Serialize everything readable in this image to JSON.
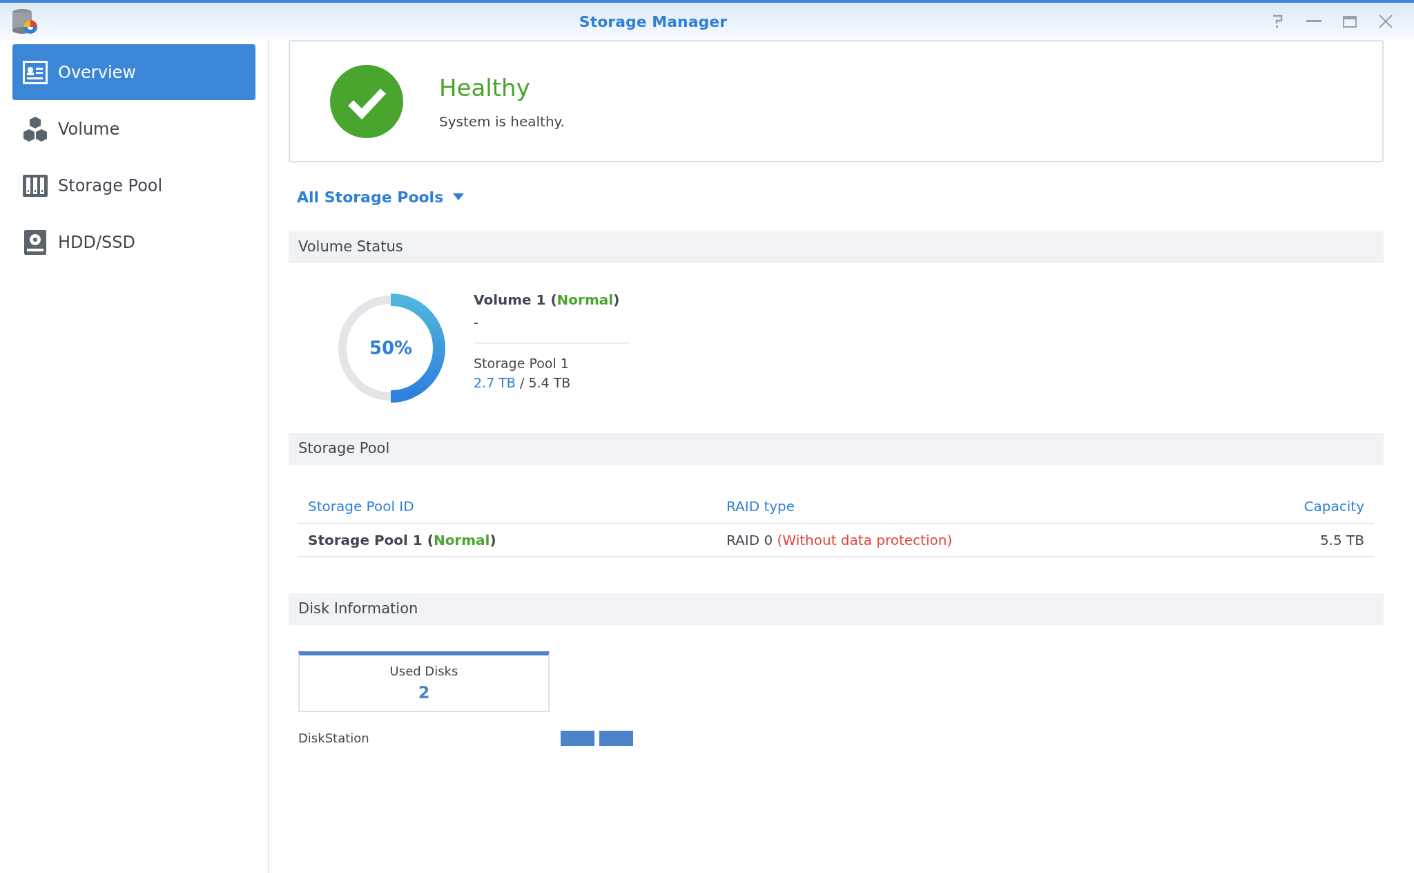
{
  "window": {
    "title": "Storage Manager"
  },
  "sidebar": {
    "items": [
      {
        "label": "Overview",
        "selected": true
      },
      {
        "label": "Volume",
        "selected": false
      },
      {
        "label": "Storage Pool",
        "selected": false
      },
      {
        "label": "HDD/SSD",
        "selected": false
      }
    ]
  },
  "health": {
    "title": "Healthy",
    "message": "System is healthy."
  },
  "pool_selector": {
    "label": "All Storage Pools"
  },
  "volume_status": {
    "heading": "Volume Status",
    "volumes": [
      {
        "level": 0.5,
        "reading": "50%",
        "name": [
          {
            "text": "Volume 1 (",
            "kind": "plain"
          },
          {
            "text": "Normal",
            "kind": "status"
          },
          {
            "text": ")",
            "kind": "plain"
          }
        ],
        "description": "-",
        "pool": "Storage Pool 1",
        "used": "2.7 TB",
        "separator": " / ",
        "total": "5.4 TB"
      }
    ]
  },
  "storage_pool": {
    "heading": "Storage Pool",
    "columns": [
      "Storage Pool ID",
      "RAID type",
      "Capacity"
    ],
    "rows": [
      [
        [
          {
            "text": "Storage Pool 1 (",
            "kind": "plain"
          },
          {
            "text": "Normal",
            "kind": "status"
          },
          {
            "text": ")",
            "kind": "plain"
          }
        ],
        [
          {
            "text": "RAID 0 ",
            "kind": "plain"
          },
          {
            "text": "(Without data protection)",
            "kind": "warning"
          }
        ],
        [
          {
            "text": "5.5 TB",
            "kind": "plain"
          }
        ]
      ]
    ]
  },
  "disk_information": {
    "heading": "Disk Information",
    "summary": {
      "label": "Used Disks",
      "value": "2"
    },
    "stations": [
      {
        "name": "DiskStation",
        "disks": [
          {
            "kind": "used"
          },
          {
            "kind": "used"
          }
        ]
      }
    ]
  }
}
